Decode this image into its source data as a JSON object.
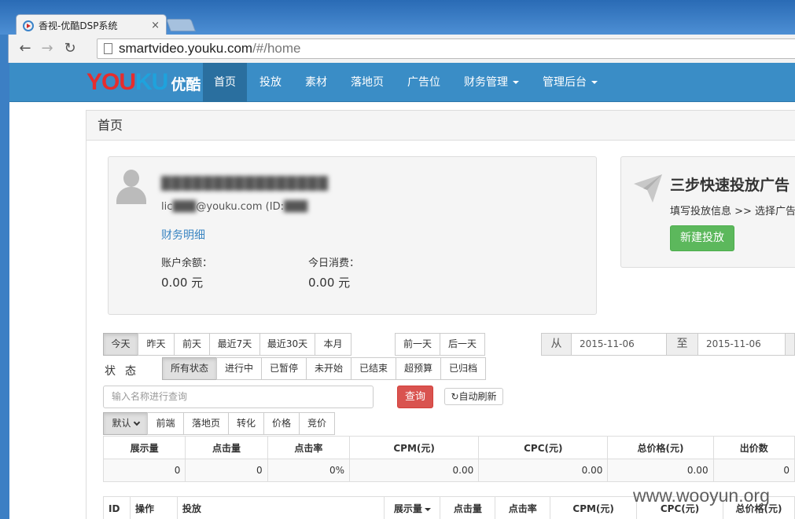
{
  "browser": {
    "tab_title": "香视-优酷DSP系统",
    "tab_close": "×",
    "url_host": "smartvideo.youku.com",
    "url_path": "/#/home",
    "back": "←",
    "forward": "→",
    "reload": "↻"
  },
  "navbar": {
    "logo_you": "YOU",
    "logo_ku": "KU",
    "logo_cn": "优酷",
    "items": [
      "首页",
      "投放",
      "素材",
      "落地页",
      "广告位",
      "财务管理",
      "管理后台"
    ]
  },
  "page": {
    "title": "首页"
  },
  "account": {
    "name": "████████████████",
    "email_prefix": "lic",
    "email_blur": "███",
    "email_domain": "@youku.com (ID:",
    "email_id_blur": "███",
    "finance_link": "财务明细",
    "balance_label": "账户余额：",
    "balance_value": "0.00 元",
    "today_label": "今日消费：",
    "today_value": "0.00 元"
  },
  "quick": {
    "title": "三步快速投放广告",
    "desc": "填写投放信息 >> 选择广告",
    "button": "新建投放"
  },
  "ranges": [
    "今天",
    "昨天",
    "前天",
    "最近7天",
    "最近30天",
    "本月"
  ],
  "day_nav": [
    "前一天",
    "后一天"
  ],
  "date_range": {
    "from_label": "从",
    "from": "2015-11-06",
    "to_label": "至",
    "to": "2015-11-06"
  },
  "status": {
    "label": "状态",
    "options": [
      "所有状态",
      "进行中",
      "已暂停",
      "未开始",
      "已结束",
      "超预算",
      "已归档"
    ]
  },
  "search": {
    "placeholder": "输入名称进行查询",
    "query": "查询",
    "refresh": "自动刷新"
  },
  "views": [
    "默认",
    "前端",
    "落地页",
    "转化",
    "价格",
    "竞价"
  ],
  "summary": {
    "headers": [
      "展示量",
      "点击量",
      "点击率",
      "CPM(元)",
      "CPC(元)",
      "总价格(元)",
      "出价数"
    ],
    "values": [
      "0",
      "0",
      "0%",
      "0.00",
      "0.00",
      "0.00",
      "0"
    ]
  },
  "main_table": {
    "headers": [
      "ID",
      "操作",
      "投放",
      "展示量",
      "点击量",
      "点击率",
      "CPM(元)",
      "CPC(元)",
      "总价格(元)"
    ]
  },
  "watermark": "www.wooyun.org",
  "colors": {
    "navbar": "#3a8dc6",
    "nav_active": "#2a6f9f",
    "query": "#d9534f",
    "new": "#5cb85c",
    "link": "#3a85c2"
  }
}
